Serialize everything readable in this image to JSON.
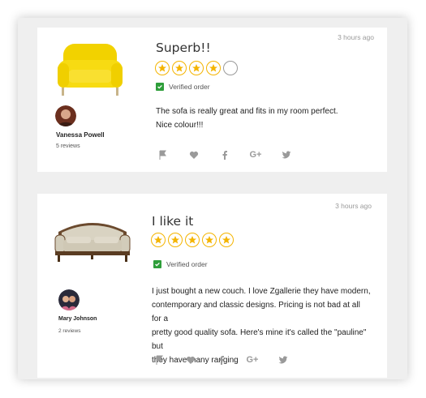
{
  "colors": {
    "star": "#f4b400",
    "verified": "#2e9e3a",
    "icon": "#9a9a9a"
  },
  "reviews": [
    {
      "time": "3 hours ago",
      "title": "Superb!!",
      "rating": 4,
      "max_rating": 5,
      "verified_label": "Verified order",
      "text_lines": [
        "The sofa is really great and fits in my room perfect.",
        "Nice colour!!!"
      ],
      "author": "Vanessa Powell",
      "review_count": "5 reviews",
      "product_icon": "yellow-sofa-image"
    },
    {
      "time": "3 hours ago",
      "title": "I like it",
      "rating": 5,
      "max_rating": 5,
      "verified_label": "Verified order",
      "text_lines": [
        "I just bought a new couch. I love Zgallerie they have modern,",
        "contemporary and classic designs. Pricing is not bad at all for a",
        "pretty good quality sofa. Here's mine it's called the \"pauline\" but",
        "they have many ranging"
      ],
      "author": "Mary Johnson",
      "review_count": "2 reviews",
      "product_icon": "beige-sofa-image"
    }
  ],
  "actions": [
    "flag-icon",
    "heart-icon",
    "facebook-icon",
    "google-plus-icon",
    "twitter-icon"
  ],
  "google_plus_label": "G+"
}
